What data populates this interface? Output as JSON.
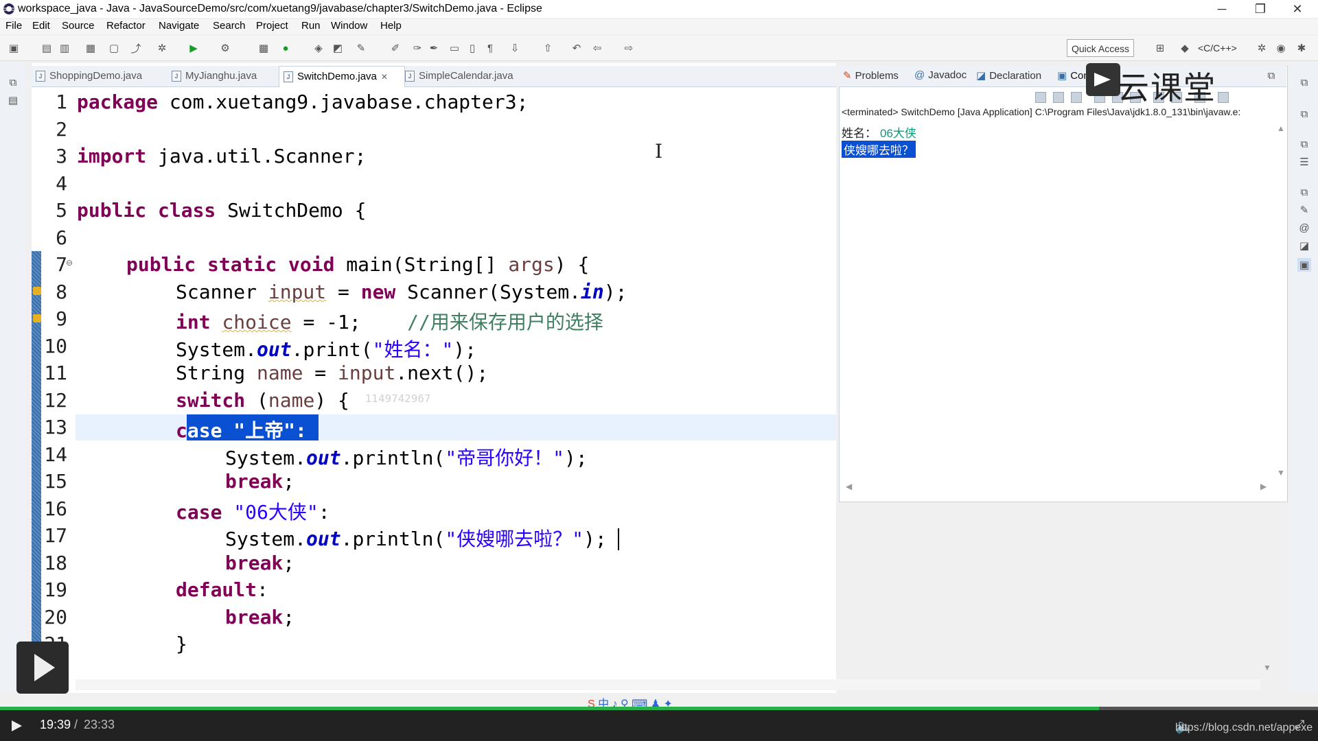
{
  "window": {
    "title": "workspace_java - Java - JavaSourceDemo/src/com/xuetang9/javabase/chapter3/SwitchDemo.java - Eclipse",
    "minimize": "─",
    "restore": "❐",
    "close": "✕"
  },
  "menu": [
    "File",
    "Edit",
    "Source",
    "Refactor",
    "Navigate",
    "Search",
    "Project",
    "Run",
    "Window",
    "Help"
  ],
  "toolbar": {
    "quick_access": "Quick Access",
    "perspective": "<C/C++>"
  },
  "editor": {
    "tabs": [
      {
        "label": "ShoppingDemo.java"
      },
      {
        "label": "MyJianghu.java"
      },
      {
        "label": "SwitchDemo.java",
        "close": "✕"
      },
      {
        "label": "SimpleCalendar.java"
      }
    ],
    "line_numbers": [
      "1",
      "2",
      "3",
      "4",
      "5",
      "6",
      "7",
      "8",
      "9",
      "10",
      "11",
      "12",
      "13",
      "14",
      "15",
      "16",
      "17",
      "18",
      "19",
      "20",
      "21"
    ],
    "fold_marker": "⊖",
    "watermark": "1149742967",
    "code": {
      "l1_kw": "package",
      "l1_rest": " com.xuetang9.javabase.chapter3;",
      "l3_kw": "import",
      "l3_rest": " java.util.Scanner;",
      "l5_kw": "public class",
      "l5_rest": " SwitchDemo {",
      "l7_kw": "public static void",
      "l7_rest": " main(String[] ",
      "l7_var": "args",
      "l7_end": ") {",
      "l8_a": "Scanner ",
      "l8_var": "input",
      "l8_b": " = ",
      "l8_kw": "new",
      "l8_c": " Scanner(System.",
      "l8_fld": "in",
      "l8_d": ");",
      "l9_kw": "int",
      "l9_a": " ",
      "l9_var": "choice",
      "l9_b": " = -1;    ",
      "l9_cmt": "//用来保存用户的选择",
      "l10_a": "System.",
      "l10_fld": "out",
      "l10_b": ".print(",
      "l10_str": "\"姓名：\"",
      "l10_c": ");",
      "l11_a": "String ",
      "l11_var": "name",
      "l11_b": " = ",
      "l11_var2": "input",
      "l11_c": ".next();",
      "l12_kw": "switch",
      "l12_a": " (",
      "l12_var": "name",
      "l12_b": ") {",
      "l13_kw1": "c",
      "l13_sel": "ase \"上帝\":",
      "l14_a": "System.",
      "l14_fld": "out",
      "l14_b": ".println(",
      "l14_str": "\"帝哥你好！\"",
      "l14_c": ");",
      "l15_kw": "break",
      "l15_a": ";",
      "l16_kw": "case",
      "l16_a": " ",
      "l16_str": "\"06大侠\"",
      "l16_b": ":",
      "l17_a": "System.",
      "l17_fld": "out",
      "l17_b": ".println(",
      "l17_str": "\"侠嫂哪去啦？\"",
      "l17_c": ");",
      "l18_kw": "break",
      "l18_a": ";",
      "l19_kw": "default",
      "l19_a": ":",
      "l20_kw": "break",
      "l20_a": ";",
      "l21_a": "}"
    }
  },
  "console": {
    "tabs": [
      {
        "label": "Problems",
        "icon": "problems-icon"
      },
      {
        "label": "Javadoc",
        "icon": "at-icon"
      },
      {
        "label": "Declaration",
        "icon": "declaration-icon"
      },
      {
        "label": "Console",
        "icon": "console-icon",
        "close": "✕"
      }
    ],
    "header": "<terminated> SwitchDemo [Java Application] C:\\Program Files\\Java\\jdk1.8.0_131\\bin\\javaw.e:",
    "prompt": "姓名：",
    "input": "06大侠",
    "output": "侠嫂哪去啦？",
    "logo": "云课堂"
  },
  "player": {
    "current_time": "19:39",
    "separator": "/",
    "total_time": "23:33",
    "progress": 0.834,
    "url": "https://blog.csdn.net/appexe"
  },
  "ime": "中 ♪ ⚲ ⌨ ♟ ✦",
  "colors": {
    "keyword": "#7f0055",
    "string": "#2a00ff",
    "comment": "#3f7f5f",
    "field": "#0000c0",
    "selection": "#0a50d2",
    "progress": "#27b04b"
  }
}
